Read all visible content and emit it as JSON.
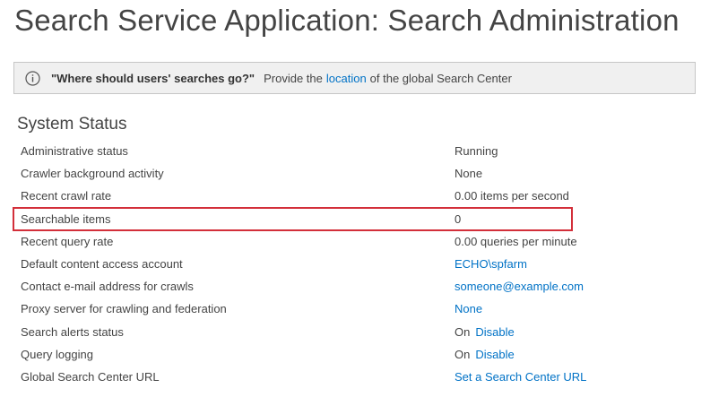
{
  "page": {
    "title": "Search Service Application: Search Administration"
  },
  "info_bar": {
    "icon": "info-icon",
    "question": "\"Where should users' searches go?\"",
    "text_before": "Provide the",
    "link_label": "location",
    "text_after": "of the global Search Center"
  },
  "system_status": {
    "title": "System Status",
    "rows": [
      {
        "label": "Administrative status",
        "value": "Running"
      },
      {
        "label": "Crawler background activity",
        "value": "None"
      },
      {
        "label": "Recent crawl rate",
        "value": "0.00 items per second"
      },
      {
        "label": "Searchable items",
        "value": "0"
      },
      {
        "label": "Recent query rate",
        "value": "0.00 queries per minute"
      },
      {
        "label": "Default content access account",
        "value": "ECHO\\spfarm"
      },
      {
        "label": "Contact e-mail address for crawls",
        "value": "someone@example.com"
      },
      {
        "label": "Proxy server for crawling and federation",
        "value": "None"
      },
      {
        "label": "Search alerts status",
        "state": "On",
        "action": "Disable"
      },
      {
        "label": "Query logging",
        "state": "On",
        "action": "Disable"
      },
      {
        "label": "Global Search Center URL",
        "value": "Set a Search Center URL"
      }
    ]
  },
  "colors": {
    "link": "#0072c6",
    "highlight_border": "#d32f3a",
    "info_bar_bg": "#f0f0f0"
  }
}
